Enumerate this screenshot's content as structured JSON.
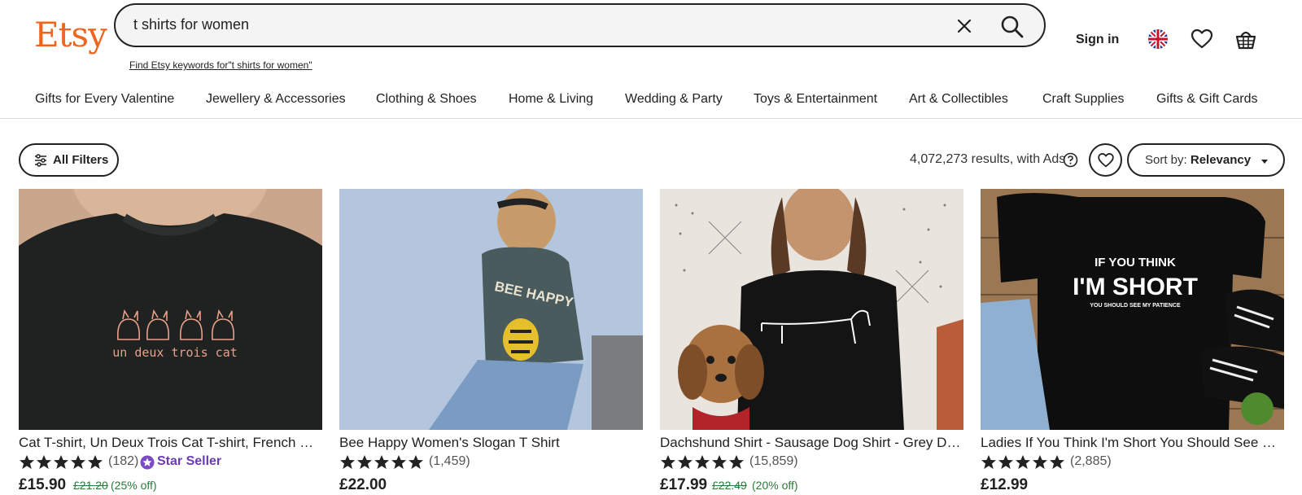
{
  "header": {
    "logo": "Etsy",
    "search_value": "t shirts for women",
    "keywords_link": "Find Etsy keywords for\"t shirts for women\"",
    "sign_in": "Sign in",
    "brand_color": "#f1641e"
  },
  "categories": [
    "Gifts for Every Valentine",
    "Jewellery & Accessories",
    "Clothing & Shoes",
    "Home & Living",
    "Wedding & Party",
    "Toys & Entertainment",
    "Art & Collectibles",
    "Craft Supplies",
    "Gifts & Gift Cards"
  ],
  "toolbar": {
    "filters_label": "All Filters",
    "results": "4,072,273 results, with Ads",
    "sort_prefix": "Sort by:",
    "sort_value": "Relevancy"
  },
  "listings": [
    {
      "title": "Cat T-shirt, Un Deux Trois Cat T-shirt, French Cat Shirt",
      "reviews": "(182)",
      "badge": "Star Seller",
      "price": "£15.90",
      "original_price": "£21.20",
      "discount": "(25% off)",
      "image_text": "un deux trois cat"
    },
    {
      "title": "Bee Happy Women's Slogan T Shirt",
      "reviews": "(1,459)",
      "price": "£22.00",
      "image_text": "BEE HAPPY"
    },
    {
      "title": "Dachshund Shirt - Sausage Dog Shirt - Grey Dachshund Tee",
      "reviews": "(15,859)",
      "price": "£17.99",
      "original_price": "£22.49",
      "discount": "(20% off)"
    },
    {
      "title": "Ladies If You Think I'm Short You Should See My Patience",
      "reviews": "(2,885)",
      "price": "£12.99",
      "image_line1": "IF YOU THINK",
      "image_line2": "I'M SHORT",
      "image_line3": "YOU SHOULD SEE MY PATIENCE"
    }
  ]
}
